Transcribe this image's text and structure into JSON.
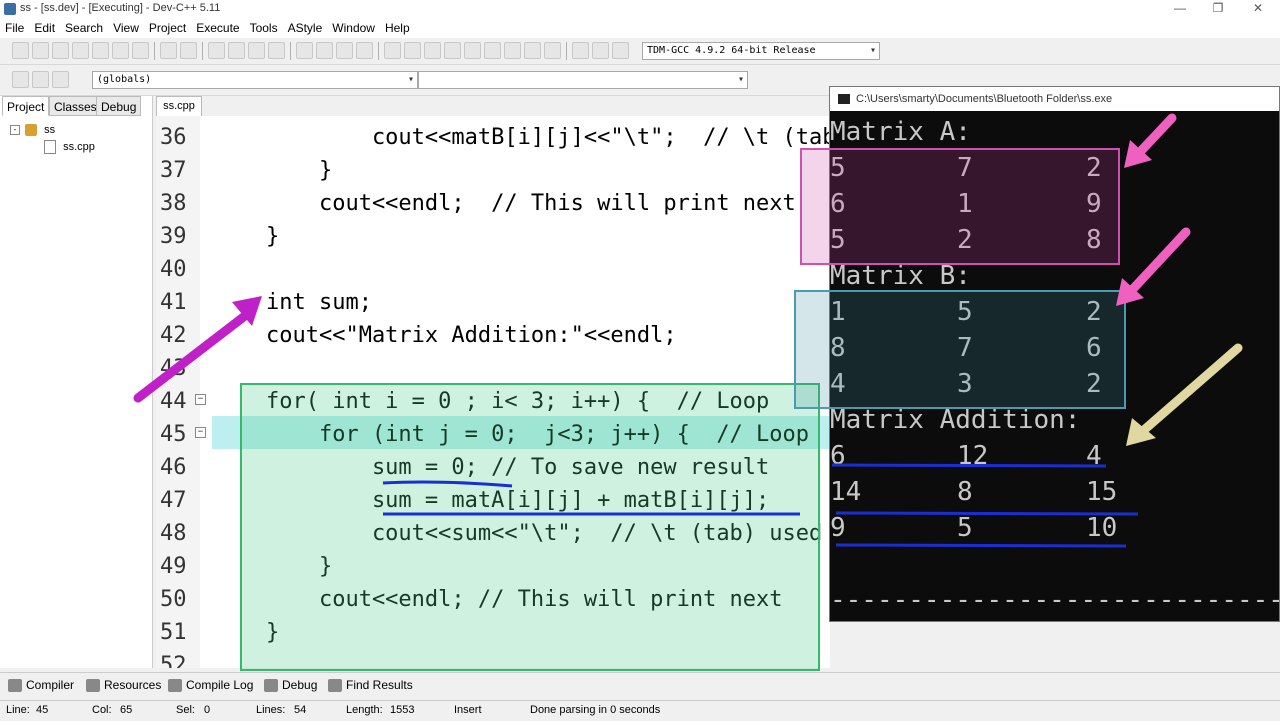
{
  "window": {
    "title": "ss - [ss.dev] - [Executing] - Dev-C++ 5.11",
    "min_glyph": "—",
    "max_glyph": "❐",
    "close_glyph": "✕"
  },
  "menu": [
    "File",
    "Edit",
    "Search",
    "View",
    "Project",
    "Execute",
    "Tools",
    "AStyle",
    "Window",
    "Help"
  ],
  "toolbar": {
    "compiler_select": "TDM-GCC 4.9.2 64-bit Release",
    "scope_select": "(globals)",
    "function_select": ""
  },
  "left_panel": {
    "tabs": [
      "Project",
      "Classes",
      "Debug"
    ],
    "tree_project": "ss",
    "tree_file": "ss.cpp"
  },
  "editor": {
    "tab": "ss.cpp",
    "lines": [
      {
        "n": "36",
        "text": "            cout<<matB[i][j]<<\"\\t\";  // \\t (tab) used"
      },
      {
        "n": "37",
        "text": "        }"
      },
      {
        "n": "38",
        "text": "        cout<<endl;  // This will print next"
      },
      {
        "n": "39",
        "text": "    }"
      },
      {
        "n": "40",
        "text": ""
      },
      {
        "n": "41",
        "text": "    int sum;"
      },
      {
        "n": "42",
        "text": "    cout<<\"Matrix Addition:\"<<endl;"
      },
      {
        "n": "43",
        "text": ""
      },
      {
        "n": "44",
        "text": "    for( int i = 0 ; i< 3; i++) {  // Loop"
      },
      {
        "n": "45",
        "text": "        for (int j = 0;  j<3; j++) {  // Loop"
      },
      {
        "n": "46",
        "text": "            sum = 0; // To save new result"
      },
      {
        "n": "47",
        "text": "            sum = matA[i][j] + matB[i][j];"
      },
      {
        "n": "48",
        "text": "            cout<<sum<<\"\\t\";  // \\t (tab) used"
      },
      {
        "n": "49",
        "text": "        }"
      },
      {
        "n": "50",
        "text": "        cout<<endl; // This will print next"
      },
      {
        "n": "51",
        "text": "    }"
      },
      {
        "n": "52",
        "text": ""
      }
    ]
  },
  "console": {
    "title": "C:\\Users\\smarty\\Documents\\Bluetooth Folder\\ss.exe",
    "rows": [
      [
        "Matrix A:"
      ],
      [
        "5",
        "7",
        "2"
      ],
      [
        "6",
        "1",
        "9"
      ],
      [
        "5",
        "2",
        "8"
      ],
      [
        "Matrix B:"
      ],
      [
        "1",
        "5",
        "2"
      ],
      [
        "8",
        "7",
        "6"
      ],
      [
        "4",
        "3",
        "2"
      ],
      [
        "Matrix Addition:"
      ],
      [
        "6",
        "12",
        "4"
      ],
      [
        "14",
        "8",
        "15"
      ],
      [
        "9",
        "5",
        "10"
      ],
      [
        ""
      ],
      [
        "------------------------------------------"
      ]
    ]
  },
  "bottom_tabs": [
    "Compiler",
    "Resources",
    "Compile Log",
    "Debug",
    "Find Results"
  ],
  "status": {
    "line_label": "Line:",
    "line": "45",
    "col_label": "Col:",
    "col": "65",
    "sel_label": "Sel:",
    "sel": "0",
    "lines_label": "Lines:",
    "lines": "54",
    "length_label": "Length:",
    "length": "1553",
    "mode": "Insert",
    "message": "Done parsing in 0 seconds"
  },
  "colors": {
    "annotation_magenta": "#c020c8",
    "annotation_pink": "#f060c0",
    "annotation_khaki": "#e0d8a0",
    "annotation_blue": "#1a2fd0",
    "highlight_green": "#7fdca0",
    "current_line": "#bdeef0"
  }
}
